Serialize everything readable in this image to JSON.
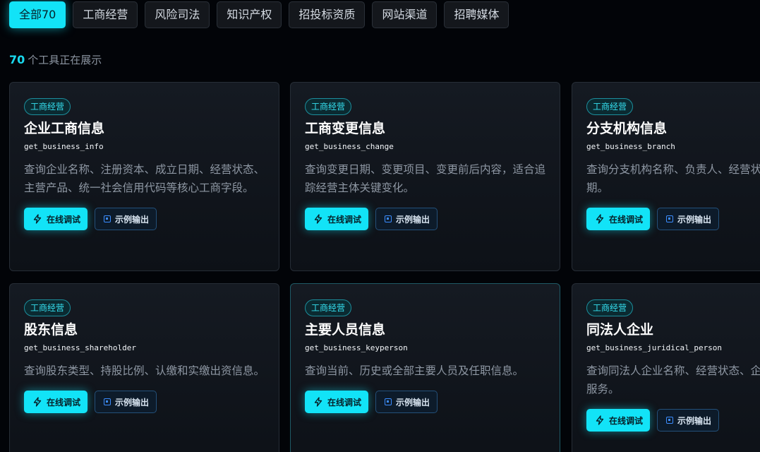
{
  "tabs": [
    {
      "label": "全部70",
      "active": true
    },
    {
      "label": "工商经营",
      "active": false
    },
    {
      "label": "风险司法",
      "active": false
    },
    {
      "label": "知识产权",
      "active": false
    },
    {
      "label": "招投标资质",
      "active": false
    },
    {
      "label": "网站渠道",
      "active": false
    },
    {
      "label": "招聘媒体",
      "active": false
    }
  ],
  "summary": {
    "count": "70",
    "text": "个工具正在展示"
  },
  "cards": [
    {
      "badge": "工商经营",
      "title": "企业工商信息",
      "code": "get_business_info",
      "desc": "查询企业名称、注册资本、成立日期、经营状态、主营产品、统一社会信用代码等核心工商字段。",
      "primary_label": "在线调试",
      "secondary_label": "示例输出"
    },
    {
      "badge": "工商经营",
      "title": "工商变更信息",
      "code": "get_business_change",
      "desc": "查询变更日期、变更项目、变更前后内容，适合追踪经营主体关键变化。",
      "primary_label": "在线调试",
      "secondary_label": "示例输出"
    },
    {
      "badge": "工商经营",
      "title": "分支机构信息",
      "code": "get_business_branch",
      "desc": "查询分支机构名称、负责人、经营状态、成立日期。",
      "primary_label": "在线调试",
      "secondary_label": "示例输出"
    },
    {
      "badge": "工商经营",
      "title": "股东信息",
      "code": "get_business_shareholder",
      "desc": "查询股东类型、持股比例、认缴和实缴出资信息。",
      "primary_label": "在线调试",
      "secondary_label": "示例输出"
    },
    {
      "badge": "工商经营",
      "title": "主要人员信息",
      "code": "get_business_keyperson",
      "desc": "查询当前、历史或全部主要人员及任职信息。",
      "primary_label": "在线调试",
      "secondary_label": "示例输出"
    },
    {
      "badge": "工商经营",
      "title": "同法人企业",
      "code": "get_business_juridical_person",
      "desc": "查询同法人企业名称、经营状态、企业类型等产品服务。",
      "primary_label": "在线调试",
      "secondary_label": "示例输出"
    }
  ],
  "icons": {
    "primary": "lightning-icon",
    "secondary": "square-icon"
  },
  "colors": {
    "accent": "#12e3f7",
    "background": "#020408",
    "secondary_border": "#23507a"
  }
}
